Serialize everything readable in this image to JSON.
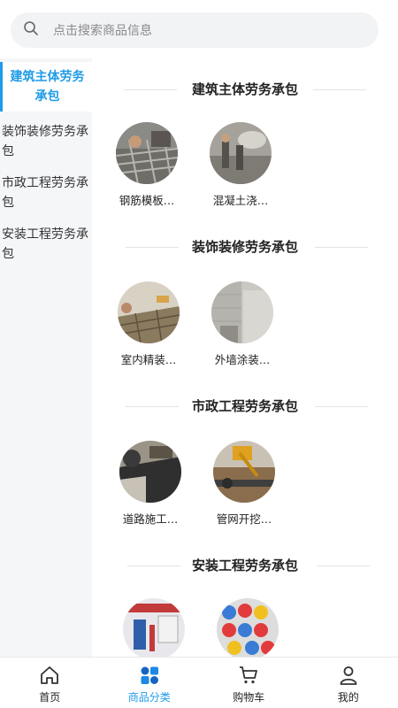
{
  "search": {
    "placeholder": "点击搜索商品信息"
  },
  "sidebar": {
    "items": [
      {
        "label": "建筑主体劳务承包"
      },
      {
        "label": "装饰装修劳务承包"
      },
      {
        "label": "市政工程劳务承包"
      },
      {
        "label": "安装工程劳务承包"
      }
    ]
  },
  "sections": [
    {
      "title": "建筑主体劳务承包",
      "items": [
        {
          "label": "钢筋模板…"
        },
        {
          "label": "混凝土浇…"
        }
      ]
    },
    {
      "title": "装饰装修劳务承包",
      "items": [
        {
          "label": "室内精装…"
        },
        {
          "label": "外墙涂装…"
        }
      ]
    },
    {
      "title": "市政工程劳务承包",
      "items": [
        {
          "label": "道路施工…"
        },
        {
          "label": "管网开挖…"
        }
      ]
    },
    {
      "title": "安装工程劳务承包",
      "items": [
        {
          "label": ""
        },
        {
          "label": ""
        }
      ]
    }
  ],
  "tabbar": {
    "tabs": [
      {
        "label": "首页",
        "icon": "home-icon"
      },
      {
        "label": "商品分类",
        "icon": "category-icon"
      },
      {
        "label": "购物车",
        "icon": "cart-icon"
      },
      {
        "label": "我的",
        "icon": "user-icon"
      }
    ]
  },
  "colors": {
    "accent": "#1e9be8",
    "sidebar_bg": "#f5f6f8",
    "search_bg": "#f2f3f5"
  }
}
